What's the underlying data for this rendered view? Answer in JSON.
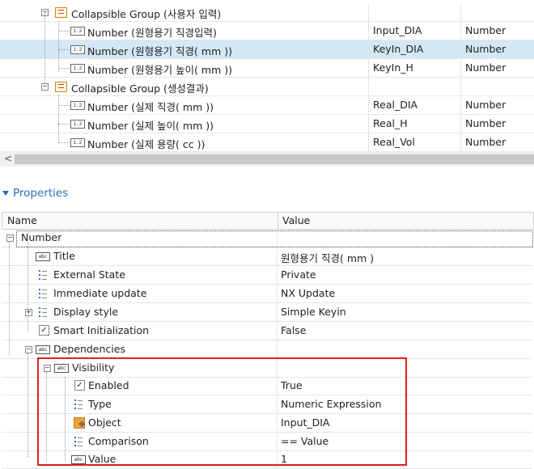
{
  "tree": {
    "rows": [
      {
        "label": "Collapsible Group (사용자 입력)",
        "id": "",
        "type": ""
      },
      {
        "label": "Number (원형용기 직경입력)",
        "id": "Input_DIA",
        "type": "Number"
      },
      {
        "label": "Number (원형용기 직경( mm ))",
        "id": "KeyIn_DIA",
        "type": "Number"
      },
      {
        "label": "Number (원형용기 높이( mm ))",
        "id": "KeyIn_H",
        "type": "Number"
      },
      {
        "label": "Collapsible Group (생성결과)",
        "id": "",
        "type": ""
      },
      {
        "label": "Number (실제 직경( mm ))",
        "id": "Real_DIA",
        "type": "Number"
      },
      {
        "label": "Number (실제 높이( mm ))",
        "id": "Real_H",
        "type": "Number"
      },
      {
        "label": "Number (실제 용량( cc ))",
        "id": "Real_Vol",
        "type": "Number"
      }
    ],
    "num_icon_text": "1.2",
    "scroll_left_glyph": "<"
  },
  "properties": {
    "title": "Properties",
    "headers": {
      "name": "Name",
      "value": "Value"
    },
    "abc_icon_text": "abc",
    "rows": [
      {
        "name": "Number",
        "value": ""
      },
      {
        "name": "Title",
        "value": "원형용기 직경( mm )"
      },
      {
        "name": "External State",
        "value": "Private"
      },
      {
        "name": "Immediate update",
        "value": "NX Update"
      },
      {
        "name": "Display style",
        "value": "Simple Keyin"
      },
      {
        "name": "Smart Initialization",
        "value": "False"
      },
      {
        "name": "Dependencies",
        "value": ""
      },
      {
        "name": "Visibility",
        "value": ""
      },
      {
        "name": "Enabled",
        "value": "True"
      },
      {
        "name": "Type",
        "value": "Numeric Expression"
      },
      {
        "name": "Object",
        "value": "Input_DIA"
      },
      {
        "name": "Comparison",
        "value": "== Value"
      },
      {
        "name": "Value",
        "value": "1"
      }
    ]
  },
  "colors": {
    "accent": "#2a6fb5",
    "selection": "#d3e8f5",
    "highlight": "#e02020"
  }
}
